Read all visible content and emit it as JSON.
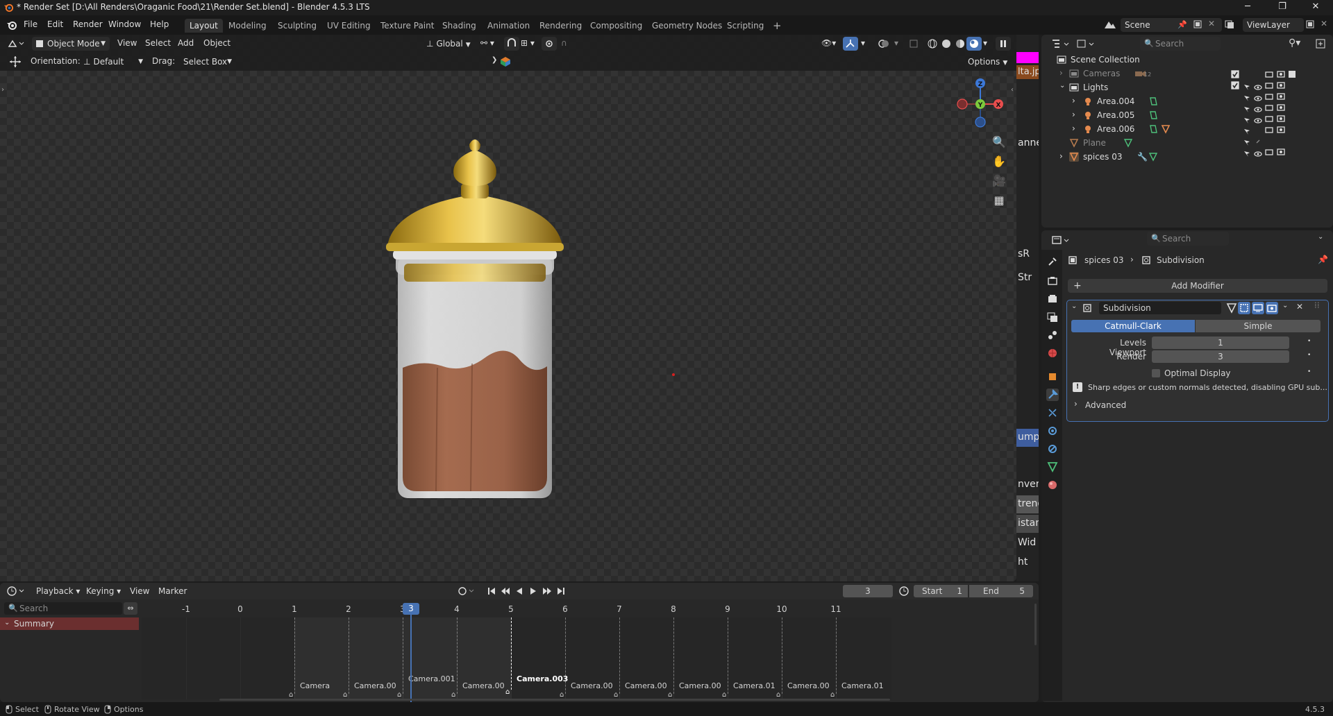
{
  "window": {
    "title": "* Render Set [D:\\All Renders\\Oraganic Food\\21\\Render Set.blend] - Blender 4.5.3 LTS",
    "minimize": "─",
    "maximize": "❐",
    "close": "✕"
  },
  "menu": [
    "File",
    "Edit",
    "Render",
    "Window",
    "Help"
  ],
  "workspaces": [
    "Layout",
    "Modeling",
    "Sculpting",
    "UV Editing",
    "Texture Paint",
    "Shading",
    "Animation",
    "Rendering",
    "Compositing",
    "Geometry Nodes",
    "Scripting"
  ],
  "workspace_add": "+",
  "scene": {
    "name": "Scene",
    "view_layer": "ViewLayer"
  },
  "viewport": {
    "mode": "Object Mode",
    "menus": [
      "View",
      "Select",
      "Add",
      "Object"
    ],
    "transform_orientation": "Global",
    "orientation_label": "Orientation:",
    "orientation_value": "Default",
    "drag_label": "Drag:",
    "drag_value": "Select Box",
    "options": "Options",
    "gizmo": {
      "z": "Z",
      "y": "Y",
      "x": "X"
    }
  },
  "side_strip": {
    "items": [
      "lta.jp",
      "anne",
      "sR",
      "Str",
      "ump",
      "nvert",
      "treng",
      "istan",
      "Wid",
      "ht"
    ]
  },
  "outliner": {
    "search_placeholder": "Search",
    "root": "Scene Collection",
    "rows": [
      {
        "name": "Cameras",
        "badge": "12"
      },
      {
        "name": "Lights"
      },
      {
        "name": "Area.004"
      },
      {
        "name": "Area.005"
      },
      {
        "name": "Area.006"
      },
      {
        "name": "Plane"
      },
      {
        "name": "spices 03"
      }
    ]
  },
  "properties": {
    "search_placeholder": "Search",
    "breadcrumb_object": "spices 03",
    "breadcrumb_modifier": "Subdivision",
    "add_modifier": "Add Modifier",
    "modifier": {
      "name": "Subdivision",
      "mode_options": [
        "Catmull-Clark",
        "Simple"
      ],
      "active_mode": "Catmull-Clark",
      "levels_viewport_label": "Levels Viewport",
      "levels_viewport": "1",
      "render_label": "Render",
      "render": "3",
      "optimal_display": "Optimal Display",
      "warning": "Sharp edges or custom normals detected, disabling GPU sub...",
      "advanced": "Advanced"
    }
  },
  "timeline": {
    "menus": [
      "Playback",
      "Keying",
      "View",
      "Marker"
    ],
    "current_frame": "3",
    "start_label": "Start",
    "start": "1",
    "end_label": "End",
    "end": "5",
    "search_placeholder": "Search",
    "summary": "Summary",
    "frames": [
      "-1",
      "0",
      "1",
      "2",
      "3",
      "4",
      "5",
      "6",
      "7",
      "8",
      "9",
      "10",
      "11"
    ],
    "cameras": [
      "Camera",
      "Camera.00",
      "Camera.001",
      "Camera.00",
      "Camera.003",
      "Camera.00",
      "Camera.00",
      "Camera.00",
      "Camera.01",
      "Camera.00",
      "Camera.01"
    ]
  },
  "statusbar": {
    "select": "Select",
    "rotate": "Rotate View",
    "options": "Options",
    "version": "4.5.3"
  },
  "colors": {
    "accent": "#4772b3",
    "active_marker": "#ffffff",
    "summary": "#6b2f2f"
  }
}
